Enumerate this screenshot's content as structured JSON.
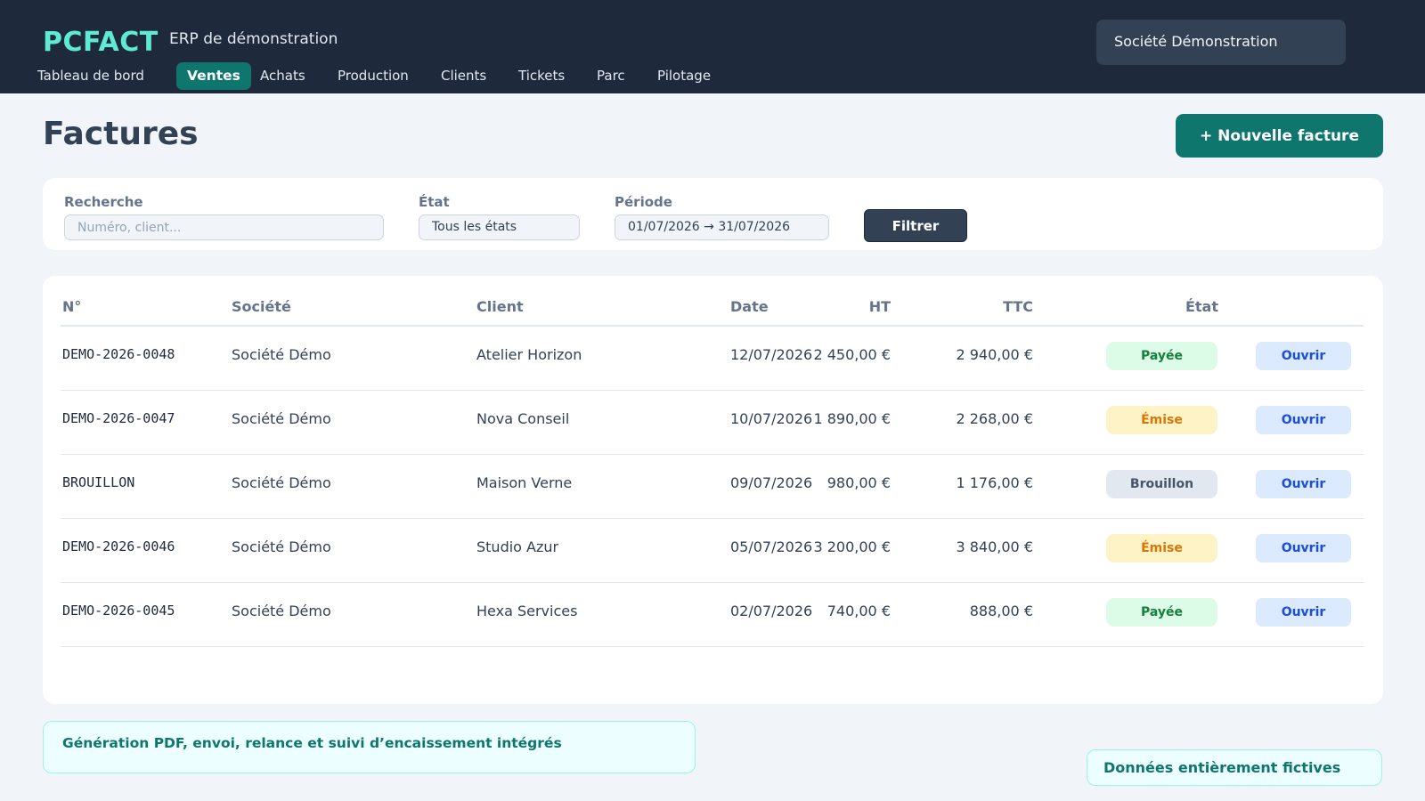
{
  "app": {
    "logo": "PCFACT",
    "tagline": "ERP de démonstration",
    "company": "Société Démonstration"
  },
  "nav": {
    "items": [
      {
        "label": "Tableau de bord",
        "active": false
      },
      {
        "label": "Ventes",
        "active": true
      },
      {
        "label": "Achats",
        "active": false
      },
      {
        "label": "Production",
        "active": false
      },
      {
        "label": "Clients",
        "active": false
      },
      {
        "label": "Tickets",
        "active": false
      },
      {
        "label": "Parc",
        "active": false
      },
      {
        "label": "Pilotage",
        "active": false
      }
    ]
  },
  "page": {
    "title": "Factures",
    "new_button": "+ Nouvelle facture"
  },
  "filters": {
    "search_label": "Recherche",
    "search_placeholder": "Numéro, client...",
    "search_value": "",
    "state_label": "État",
    "state_value": "Tous les états",
    "period_label": "Période",
    "period_value": "01/07/2026 → 31/07/2026",
    "submit": "Filtrer"
  },
  "table": {
    "headers": [
      "N°",
      "Société",
      "Client",
      "Date",
      "HT",
      "TTC",
      "État"
    ],
    "rows": [
      {
        "num": "DEMO-2026-0048",
        "company": "Société Démo",
        "client": "Atelier Horizon",
        "date": "12/07/2026",
        "ht": "2 450,00 €",
        "ttc": "2 940,00 €",
        "state": "Payée",
        "action": "Ouvrir"
      },
      {
        "num": "DEMO-2026-0047",
        "company": "Société Démo",
        "client": "Nova Conseil",
        "date": "10/07/2026",
        "ht": "1 890,00 €",
        "ttc": "2 268,00 €",
        "state": "Émise",
        "action": "Ouvrir"
      },
      {
        "num": "BROUILLON",
        "company": "Société Démo",
        "client": "Maison Verne",
        "date": "09/07/2026",
        "ht": "980,00 €",
        "ttc": "1 176,00 €",
        "state": "Brouillon",
        "action": "Ouvrir"
      },
      {
        "num": "DEMO-2026-0046",
        "company": "Société Démo",
        "client": "Studio Azur",
        "date": "05/07/2026",
        "ht": "3 200,00 €",
        "ttc": "3 840,00 €",
        "state": "Émise",
        "action": "Ouvrir"
      },
      {
        "num": "DEMO-2026-0045",
        "company": "Société Démo",
        "client": "Hexa Services",
        "date": "02/07/2026",
        "ht": "740,00 €",
        "ttc": "888,00 €",
        "state": "Payée",
        "action": "Ouvrir"
      }
    ]
  },
  "status_colors": {
    "Payée": {
      "bg": "#dcfce7",
      "fg": "#15803d"
    },
    "Émise": {
      "bg": "#fef3c7",
      "fg": "#d97706"
    },
    "Brouillon": {
      "bg": "#e2e8f0",
      "fg": "#475569"
    }
  },
  "notes": {
    "features": "Génération PDF, envoi, relance et suivi d’encaissement intégrés",
    "fictive": "Données entièrement fictives"
  }
}
